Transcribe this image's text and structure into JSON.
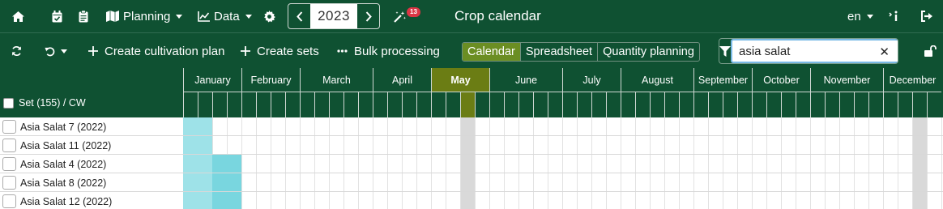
{
  "topnav": {
    "home_icon": "home-icon",
    "calendar_icon": "calendar-check-icon",
    "clipboard_icon": "clipboard-icon",
    "planning_label": "Planning",
    "data_label": "Data",
    "year": "2023",
    "notifications_count": "13",
    "title": "Crop calendar",
    "language": "en"
  },
  "toolbar": {
    "create_plan_label": "Create cultivation plan",
    "create_sets_label": "Create sets",
    "bulk_label": "Bulk processing",
    "views": [
      "Calendar",
      "Spreadsheet",
      "Quantity planning"
    ],
    "active_view": "Calendar",
    "search_value": "asia salat",
    "search_placeholder": ""
  },
  "grid": {
    "set_header": "Set (155) / CW",
    "months": [
      "January",
      "February",
      "March",
      "April",
      "May",
      "June",
      "July",
      "August",
      "September",
      "October",
      "November",
      "December"
    ],
    "current_month": "May",
    "colors": {
      "header_bg": "#0f5132",
      "highlight": "#6b7d14",
      "bar_light": "#9ee2e8",
      "bar_dark": "#79d6df",
      "today_col": "#d9d9d9"
    },
    "rows": [
      {
        "name": "Asia Salat 7 (2022)"
      },
      {
        "name": "Asia Salat 11 (2022)"
      },
      {
        "name": "Asia Salat 4 (2022)"
      },
      {
        "name": "Asia Salat 8 (2022)"
      },
      {
        "name": "Asia Salat 12 (2022)"
      }
    ]
  }
}
